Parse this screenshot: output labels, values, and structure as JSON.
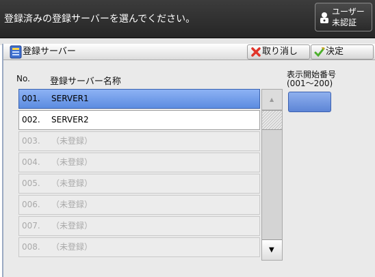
{
  "header": {
    "message": "登録済みの登録サーバーを選んでください。",
    "user_button": {
      "line1": "ユーザー",
      "line2": "未認証",
      "icon": "user-lock-icon"
    }
  },
  "panel": {
    "title": "登録サーバー",
    "title_icon": "server-icon",
    "cancel_label": "取り消し",
    "cancel_icon": "x-icon",
    "ok_label": "決定",
    "ok_icon": "checkmark-icon",
    "columns": {
      "no": "No.",
      "name": "登録サーバー名称"
    },
    "start_number": {
      "label_line1": "表示開始番号",
      "label_line2": "(001～200)",
      "value": ""
    },
    "rows": [
      {
        "no": "001.",
        "name": "SERVER1",
        "state": "selected"
      },
      {
        "no": "002.",
        "name": "SERVER2",
        "state": "registered"
      },
      {
        "no": "003.",
        "name": "（未登録）",
        "state": "empty"
      },
      {
        "no": "004.",
        "name": "（未登録）",
        "state": "empty"
      },
      {
        "no": "005.",
        "name": "（未登録）",
        "state": "empty"
      },
      {
        "no": "006.",
        "name": "（未登録）",
        "state": "empty"
      },
      {
        "no": "007.",
        "name": "（未登録）",
        "state": "empty"
      },
      {
        "no": "008.",
        "name": "（未登録）",
        "state": "empty"
      }
    ]
  },
  "colors": {
    "selected_row": "#6f9be6",
    "topbar": "#303030",
    "empty_text": "#a9a9a9"
  }
}
